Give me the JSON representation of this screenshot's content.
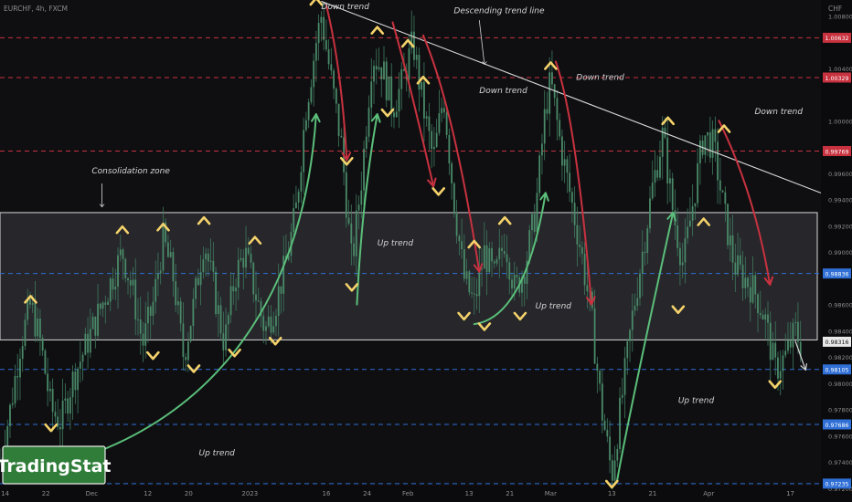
{
  "header": {
    "title": "EURCHF, 4h, FXCM",
    "currency": "CHF"
  },
  "watermark": "TradingStat",
  "colors": {
    "background": "#0f0f12",
    "candle": "#4a8a68",
    "wick": "#3f7a5c",
    "up_arrow": "#5bbf7a",
    "down_arrow": "#c8323f",
    "marker": "#f5d36b",
    "red_level": "#c8323f",
    "blue_level": "#2f6fd6",
    "zone_fill": "#3a3a40",
    "zone_border": "#d8d8d8",
    "trend_line": "#d9d9d9",
    "text": "#d6d6d6",
    "axis_text": "#8c8c8c",
    "logo_bg": "#2f7d39"
  },
  "annotations": [
    {
      "text": "Down trend",
      "x": "2023-01-15",
      "y": 1.0085
    },
    {
      "text": "Descending trend line",
      "x": "2023-02-10",
      "y": 1.0082
    },
    {
      "text": "Down trend",
      "x": "2023-02-15",
      "y": 1.0021
    },
    {
      "text": "Down trend",
      "x": "2023-03-06",
      "y": 1.0031
    },
    {
      "text": "Down trend",
      "x": "2023-04-10",
      "y": 1.0005
    },
    {
      "text": "Consolidation zone",
      "x": "2022-12-01",
      "y": 0.996
    },
    {
      "text": "Up trend",
      "x": "2023-01-26",
      "y": 0.9905
    },
    {
      "text": "Up trend",
      "x": "2023-02-26",
      "y": 0.9857
    },
    {
      "text": "Up trend",
      "x": "2023-03-26",
      "y": 0.9785
    },
    {
      "text": "Up trend",
      "x": "2022-12-22",
      "y": 0.9745
    }
  ],
  "chart_data": {
    "type": "candlestick",
    "symbol": "EURCHF",
    "timeframe": "4h",
    "source": "FXCM",
    "x_range": [
      "2022-11-13",
      "2023-04-23"
    ],
    "ylim": [
      0.9722,
      1.0092
    ],
    "y_ticks": [
      "1.00800",
      "1.00400",
      "1.00000",
      "0.99600",
      "0.99400",
      "0.99200",
      "0.99000",
      "0.98600",
      "0.98400",
      "0.98200",
      "0.98000",
      "0.97800",
      "0.97600",
      "0.97400",
      "0.97200"
    ],
    "y_tick_values": [
      1.008,
      1.004,
      1.0,
      0.996,
      0.994,
      0.992,
      0.99,
      0.986,
      0.984,
      0.982,
      0.98,
      0.978,
      0.976,
      0.974,
      0.972
    ],
    "x_ticks": [
      {
        "label": "14",
        "date": "2022-11-14"
      },
      {
        "label": "22",
        "date": "2022-11-22"
      },
      {
        "label": "Dec",
        "date": "2022-12-01"
      },
      {
        "label": "12",
        "date": "2022-12-12"
      },
      {
        "label": "20",
        "date": "2022-12-20"
      },
      {
        "label": "2023",
        "date": "2023-01-01"
      },
      {
        "label": "16",
        "date": "2023-01-16"
      },
      {
        "label": "24",
        "date": "2023-01-24"
      },
      {
        "label": "Feb",
        "date": "2023-02-01"
      },
      {
        "label": "13",
        "date": "2023-02-13"
      },
      {
        "label": "21",
        "date": "2023-02-21"
      },
      {
        "label": "Mar",
        "date": "2023-03-01"
      },
      {
        "label": "13",
        "date": "2023-03-13"
      },
      {
        "label": "21",
        "date": "2023-03-21"
      },
      {
        "label": "Apr",
        "date": "2023-04-01"
      },
      {
        "label": "17",
        "date": "2023-04-17"
      }
    ],
    "price_levels": [
      {
        "value": 1.00632,
        "label": "1.00632",
        "style": "red"
      },
      {
        "value": 1.00329,
        "label": "1.00329",
        "style": "red"
      },
      {
        "value": 0.99769,
        "label": "0.99769",
        "style": "red"
      },
      {
        "value": 0.98836,
        "label": "0.98836",
        "style": "blue"
      },
      {
        "value": 0.98316,
        "label": "0.98316",
        "style": "current"
      },
      {
        "value": 0.98105,
        "label": "0.98105",
        "style": "blue"
      },
      {
        "value": 0.97686,
        "label": "0.97686",
        "style": "blue"
      },
      {
        "value": 0.97235,
        "label": "0.97235",
        "style": "blue"
      }
    ],
    "consolidation_zone": {
      "from": "2022-11-13",
      "to": "2023-04-23",
      "low": 0.9833,
      "high": 0.993
    },
    "descending_trend_line": [
      {
        "x": "2023-01-15",
        "y": 1.0091
      },
      {
        "x": "2023-04-23",
        "y": 0.9945
      }
    ],
    "close_path": [
      [
        "2022-11-13",
        0.974
      ],
      [
        "2022-11-15",
        0.978
      ],
      [
        "2022-11-17",
        0.983
      ],
      [
        "2022-11-19",
        0.986
      ],
      [
        "2022-11-21",
        0.983
      ],
      [
        "2022-11-23",
        0.978
      ],
      [
        "2022-11-25",
        0.977
      ],
      [
        "2022-11-27",
        0.98
      ],
      [
        "2022-11-29",
        0.982
      ],
      [
        "2022-12-01",
        0.984
      ],
      [
        "2022-12-04",
        0.987
      ],
      [
        "2022-12-07",
        0.99
      ],
      [
        "2022-12-09",
        0.987
      ],
      [
        "2022-12-11",
        0.983
      ],
      [
        "2022-12-13",
        0.986
      ],
      [
        "2022-12-15",
        0.991
      ],
      [
        "2022-12-17",
        0.988
      ],
      [
        "2022-12-19",
        0.982
      ],
      [
        "2022-12-21",
        0.986
      ],
      [
        "2022-12-23",
        0.991
      ],
      [
        "2022-12-25",
        0.987
      ],
      [
        "2022-12-27",
        0.983
      ],
      [
        "2022-12-29",
        0.988
      ],
      [
        "2022-12-31",
        0.99
      ],
      [
        "2023-01-02",
        0.987
      ],
      [
        "2023-01-04",
        0.984
      ],
      [
        "2023-01-06",
        0.986
      ],
      [
        "2023-01-08",
        0.989
      ],
      [
        "2023-01-10",
        0.993
      ],
      [
        "2023-01-12",
        1.001
      ],
      [
        "2023-01-14",
        1.006
      ],
      [
        "2023-01-15",
        1.008
      ],
      [
        "2023-01-17",
        1.003
      ],
      [
        "2023-01-19",
        0.998
      ],
      [
        "2023-01-21",
        0.989
      ],
      [
        "2023-01-23",
        0.996
      ],
      [
        "2023-01-25",
        1.005
      ],
      [
        "2023-01-27",
        1.004
      ],
      [
        "2023-01-29",
        1.001
      ],
      [
        "2023-01-31",
        1.003
      ],
      [
        "2023-02-02",
        1.006
      ],
      [
        "2023-02-04",
        1.001
      ],
      [
        "2023-02-06",
        0.997
      ],
      [
        "2023-02-08",
        1.002
      ],
      [
        "2023-02-10",
        0.994
      ],
      [
        "2023-02-12",
        0.988
      ],
      [
        "2023-02-14",
        0.986
      ],
      [
        "2023-02-16",
        0.99
      ],
      [
        "2023-02-18",
        0.988
      ],
      [
        "2023-02-20",
        0.991
      ],
      [
        "2023-02-22",
        0.987
      ],
      [
        "2023-02-24",
        0.989
      ],
      [
        "2023-02-26",
        0.993
      ],
      [
        "2023-02-28",
        1.001
      ],
      [
        "2023-03-01",
        1.003
      ],
      [
        "2023-03-03",
        0.998
      ],
      [
        "2023-03-05",
        0.994
      ],
      [
        "2023-03-07",
        0.99
      ],
      [
        "2023-03-09",
        0.985
      ],
      [
        "2023-03-11",
        0.978
      ],
      [
        "2023-03-13",
        0.973
      ],
      [
        "2023-03-15",
        0.979
      ],
      [
        "2023-03-17",
        0.985
      ],
      [
        "2023-03-19",
        0.99
      ],
      [
        "2023-03-21",
        0.995
      ],
      [
        "2023-03-23",
        0.999
      ],
      [
        "2023-03-25",
        0.993
      ],
      [
        "2023-03-27",
        0.989
      ],
      [
        "2023-03-29",
        0.994
      ],
      [
        "2023-03-31",
        0.999
      ],
      [
        "2023-04-02",
        0.998
      ],
      [
        "2023-04-04",
        0.993
      ],
      [
        "2023-04-06",
        0.989
      ],
      [
        "2023-04-08",
        0.988
      ],
      [
        "2023-04-10",
        0.987
      ],
      [
        "2023-04-12",
        0.985
      ],
      [
        "2023-04-14",
        0.981
      ],
      [
        "2023-04-16",
        0.982
      ],
      [
        "2023-04-18",
        0.984
      ],
      [
        "2023-04-19",
        0.983
      ]
    ],
    "swing_markers": [
      {
        "x": "2022-11-19",
        "y": 0.9865,
        "kind": "high"
      },
      {
        "x": "2022-11-23",
        "y": 0.9765,
        "kind": "low"
      },
      {
        "x": "2022-12-07",
        "y": 0.9918,
        "kind": "high"
      },
      {
        "x": "2022-12-13",
        "y": 0.982,
        "kind": "low"
      },
      {
        "x": "2022-12-15",
        "y": 0.992,
        "kind": "high"
      },
      {
        "x": "2022-12-21",
        "y": 0.981,
        "kind": "low"
      },
      {
        "x": "2022-12-23",
        "y": 0.9925,
        "kind": "high"
      },
      {
        "x": "2022-12-29",
        "y": 0.9822,
        "kind": "low"
      },
      {
        "x": "2023-01-02",
        "y": 0.991,
        "kind": "high"
      },
      {
        "x": "2023-01-06",
        "y": 0.9831,
        "kind": "low"
      },
      {
        "x": "2023-01-14",
        "y": 1.0092,
        "kind": "high"
      },
      {
        "x": "2023-01-20",
        "y": 0.9968,
        "kind": "low"
      },
      {
        "x": "2023-01-21",
        "y": 0.9872,
        "kind": "low"
      },
      {
        "x": "2023-01-26",
        "y": 1.007,
        "kind": "high"
      },
      {
        "x": "2023-01-28",
        "y": 1.0005,
        "kind": "low"
      },
      {
        "x": "2023-02-01",
        "y": 1.006,
        "kind": "high"
      },
      {
        "x": "2023-02-04",
        "y": 1.0032,
        "kind": "high"
      },
      {
        "x": "2023-02-07",
        "y": 0.9945,
        "kind": "low"
      },
      {
        "x": "2023-02-12",
        "y": 0.985,
        "kind": "low"
      },
      {
        "x": "2023-02-14",
        "y": 0.9907,
        "kind": "high"
      },
      {
        "x": "2023-02-16",
        "y": 0.9842,
        "kind": "low"
      },
      {
        "x": "2023-02-20",
        "y": 0.9925,
        "kind": "high"
      },
      {
        "x": "2023-02-23",
        "y": 0.985,
        "kind": "low"
      },
      {
        "x": "2023-03-01",
        "y": 1.0043,
        "kind": "high"
      },
      {
        "x": "2023-03-13",
        "y": 0.9722,
        "kind": "low"
      },
      {
        "x": "2023-03-24",
        "y": 1.0001,
        "kind": "high"
      },
      {
        "x": "2023-03-26",
        "y": 0.9855,
        "kind": "low"
      },
      {
        "x": "2023-03-31",
        "y": 0.9924,
        "kind": "high"
      },
      {
        "x": "2023-04-04",
        "y": 0.9995,
        "kind": "high"
      },
      {
        "x": "2023-04-14",
        "y": 0.9798,
        "kind": "low"
      }
    ],
    "trend_arrows": [
      {
        "trend": "up",
        "points": [
          [
            "2022-11-16",
            0.973
          ],
          [
            "2022-12-28",
            0.976
          ],
          [
            "2023-01-12",
            0.988
          ],
          [
            "2023-01-14",
            1.0005
          ]
        ]
      },
      {
        "trend": "up",
        "points": [
          [
            "2023-01-22",
            0.986
          ],
          [
            "2023-01-23",
            0.994
          ],
          [
            "2023-01-26",
            1.0005
          ]
        ]
      },
      {
        "trend": "up",
        "points": [
          [
            "2023-02-14",
            0.9845
          ],
          [
            "2023-02-24",
            0.985
          ],
          [
            "2023-02-28",
            0.9945
          ]
        ]
      },
      {
        "trend": "up",
        "points": [
          [
            "2023-03-14",
            0.9725
          ],
          [
            "2023-03-16",
            0.977
          ],
          [
            "2023-03-25",
            0.993
          ]
        ]
      },
      {
        "trend": "down",
        "points": [
          [
            "2023-01-16",
            1.0088
          ],
          [
            "2023-01-19",
            1.004
          ],
          [
            "2023-01-20",
            0.997
          ]
        ]
      },
      {
        "trend": "down",
        "points": [
          [
            "2023-01-29",
            1.0075
          ],
          [
            "2023-02-01",
            1.0035
          ],
          [
            "2023-02-06",
            0.995
          ]
        ]
      },
      {
        "trend": "down",
        "points": [
          [
            "2023-02-04",
            1.0065
          ],
          [
            "2023-02-10",
            1.001
          ],
          [
            "2023-02-15",
            0.9885
          ]
        ]
      },
      {
        "trend": "down",
        "points": [
          [
            "2023-03-02",
            1.0045
          ],
          [
            "2023-03-06",
            1.0
          ],
          [
            "2023-03-09",
            0.986
          ]
        ]
      },
      {
        "trend": "down",
        "points": [
          [
            "2023-04-03",
            1.0
          ],
          [
            "2023-04-10",
            0.9945
          ],
          [
            "2023-04-13",
            0.9875
          ]
        ]
      },
      {
        "trend": "projection",
        "points": [
          [
            "2023-04-18",
            0.9832
          ],
          [
            "2023-04-20",
            0.981
          ]
        ]
      }
    ]
  }
}
